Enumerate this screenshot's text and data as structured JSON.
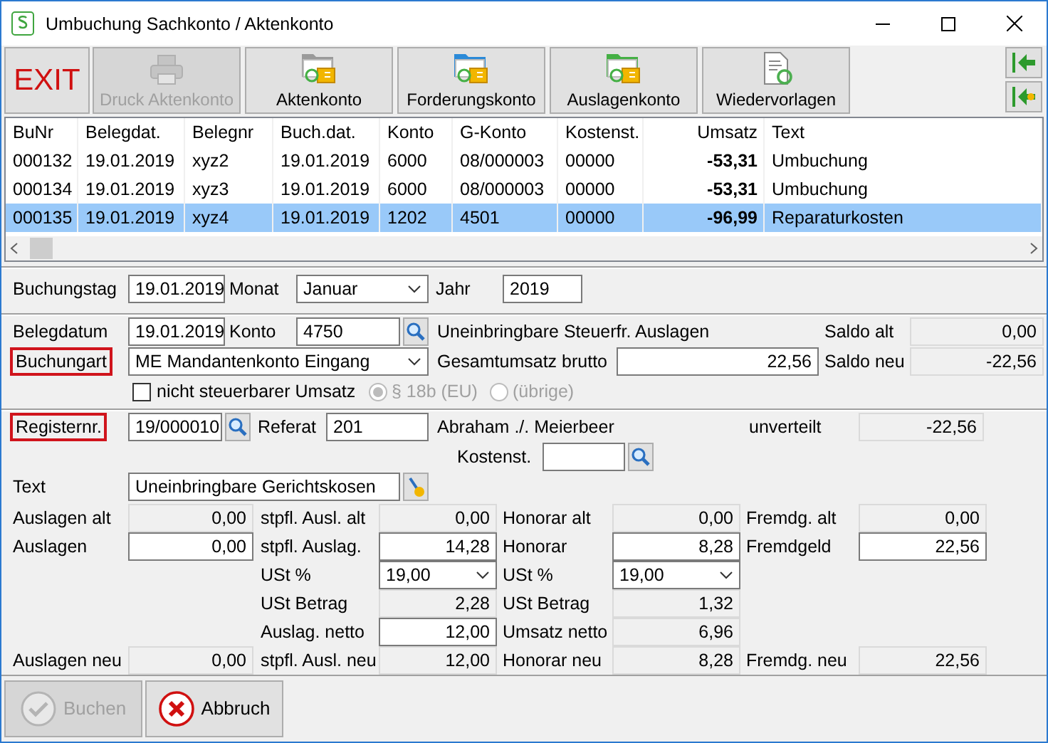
{
  "window": {
    "title": "Umbuchung Sachkonto / Aktenkonto"
  },
  "toolbar": [
    {
      "kind": "exit",
      "label": "EXIT",
      "disabled": false
    },
    {
      "kind": "print",
      "label": "Druck Aktenkonto",
      "disabled": true
    },
    {
      "kind": "file",
      "label": "Aktenkonto",
      "disabled": false
    },
    {
      "kind": "claims",
      "label": "Forderungskonto",
      "disabled": false
    },
    {
      "kind": "expenses",
      "label": "Auslagenkonto",
      "disabled": false
    },
    {
      "kind": "resubmit",
      "label": "Wiedervorlagen",
      "disabled": false
    }
  ],
  "table": {
    "columns": [
      {
        "label": "BuNr",
        "kind": "text"
      },
      {
        "label": "Belegdat.",
        "kind": "text"
      },
      {
        "label": "Belegnr",
        "kind": "text"
      },
      {
        "label": "Buch.dat.",
        "kind": "text"
      },
      {
        "label": "Konto",
        "kind": "text"
      },
      {
        "label": "G-Konto",
        "kind": "text"
      },
      {
        "label": "Kostenst.",
        "kind": "text"
      },
      {
        "label": "Umsatz",
        "kind": "amount"
      },
      {
        "label": "Text",
        "kind": "text"
      }
    ],
    "rows": [
      {
        "selected": false,
        "cells": [
          "000132",
          "19.01.2019",
          "xyz2",
          "19.01.2019",
          "6000",
          "08/000003",
          "00000",
          "-53,31",
          "Umbuchung"
        ]
      },
      {
        "selected": false,
        "cells": [
          "000134",
          "19.01.2019",
          "xyz3",
          "19.01.2019",
          "6000",
          "08/000003",
          "00000",
          "-53,31",
          "Umbuchung"
        ]
      },
      {
        "selected": true,
        "cells": [
          "000135",
          "19.01.2019",
          "xyz4",
          "19.01.2019",
          "1202",
          "4501",
          "00000",
          "-96,99",
          "Reparaturkosten"
        ]
      }
    ]
  },
  "period": {
    "day": {
      "label": "Buchungstag",
      "value": "19.01.2019"
    },
    "month": {
      "label": "Monat",
      "value": "Januar"
    },
    "year": {
      "label": "Jahr",
      "value": "2019"
    }
  },
  "document": {
    "date": {
      "label": "Belegdatum",
      "value": "19.01.2019"
    },
    "account": {
      "label": "Konto",
      "value": "4750"
    },
    "account_name": "Uneinbringbare Steuerfr. Auslagen",
    "type": {
      "label": "Buchungart",
      "value": "ME Mandantenkonto Eingang",
      "highlighted": true
    },
    "gross": {
      "label": "Gesamtumsatz brutto",
      "value": "22,56"
    },
    "balance_old": {
      "label": "Saldo alt",
      "value": "0,00"
    },
    "balance_new": {
      "label": "Saldo neu",
      "value": "-22,56"
    },
    "not_taxable": {
      "label": "nicht steuerbarer Umsatz",
      "checked": false
    },
    "radios": [
      {
        "label": "§ 18b (EU)",
        "selected": true,
        "disabled": true
      },
      {
        "label": "(übrige)",
        "selected": false,
        "disabled": true
      }
    ]
  },
  "register": {
    "number": {
      "label": "Registernr.",
      "value": "19/000010",
      "highlighted": true
    },
    "referat": {
      "label": "Referat",
      "value": "201"
    },
    "client": "Abraham ./. Meierbeer",
    "unassigned": {
      "label": "unverteilt",
      "value": "-22,56"
    },
    "cost_center": {
      "label": "Kostenst."
    },
    "text": {
      "label": "Text",
      "value": "Uneinbringbare Gerichtskosen"
    }
  },
  "amounts": [
    {
      "expenses": {
        "label": "Auslagen alt",
        "value": "0,00",
        "kind": "readonly"
      },
      "taxable": {
        "label": "stpfl. Ausl. alt",
        "value": "0,00",
        "kind": "readonly"
      },
      "fee": {
        "label": "Honorar alt",
        "value": "0,00",
        "kind": "readonly"
      },
      "foreign": {
        "label": "Fremdg. alt",
        "value": "0,00",
        "kind": "readonly"
      }
    },
    {
      "expenses": {
        "label": "Auslagen",
        "value": "0,00",
        "kind": "input"
      },
      "taxable": {
        "label": "stpfl. Auslag.",
        "value": "14,28",
        "kind": "input"
      },
      "fee": {
        "label": "Honorar",
        "value": "8,28",
        "kind": "input"
      },
      "foreign": {
        "label": "Fremdgeld",
        "value": "22,56",
        "kind": "input"
      }
    },
    {
      "taxable": {
        "label": "USt %",
        "value": "19,00",
        "kind": "select"
      },
      "fee": {
        "label": "USt %",
        "value": "19,00",
        "kind": "select"
      }
    },
    {
      "taxable": {
        "label": "USt Betrag",
        "value": "2,28",
        "kind": "readonly"
      },
      "fee": {
        "label": "USt Betrag",
        "value": "1,32",
        "kind": "readonly"
      }
    },
    {
      "taxable": {
        "label": "Auslag. netto",
        "value": "12,00",
        "kind": "input"
      },
      "fee": {
        "label": "Umsatz netto",
        "value": "6,96",
        "kind": "readonly"
      }
    },
    {
      "expenses": {
        "label": "Auslagen neu",
        "value": "0,00",
        "kind": "readonly"
      },
      "taxable": {
        "label": "stpfl. Ausl. neu",
        "value": "12,00",
        "kind": "readonly"
      },
      "fee": {
        "label": "Honorar neu",
        "value": "8,28",
        "kind": "readonly"
      },
      "foreign": {
        "label": "Fremdg. neu",
        "value": "22,56",
        "kind": "readonly"
      }
    }
  ],
  "footer": [
    {
      "kind": "ok",
      "label": "Buchen",
      "disabled": true
    },
    {
      "kind": "cancel",
      "label": "Abbruch",
      "disabled": false
    }
  ]
}
